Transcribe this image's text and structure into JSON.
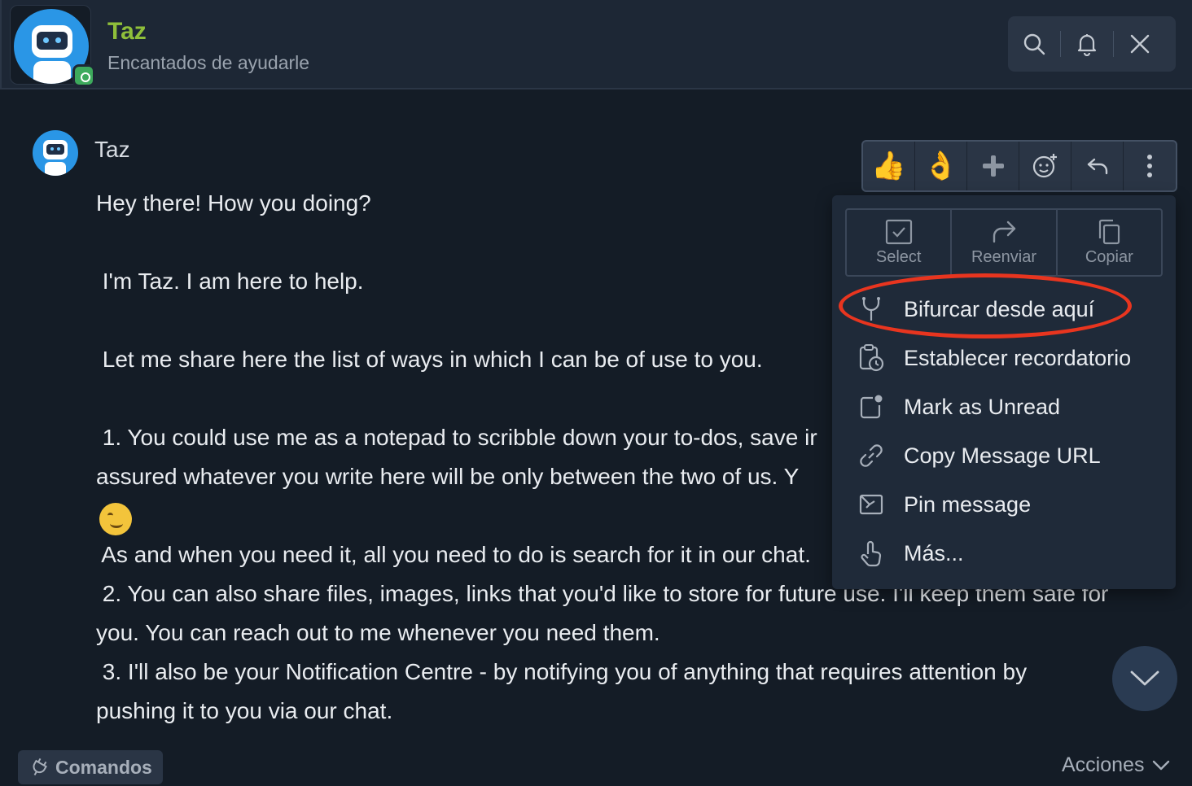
{
  "header": {
    "title": "Taz",
    "subtitle": "Encantados de ayudarle",
    "actions": [
      "search-icon",
      "bell-icon",
      "close-icon"
    ]
  },
  "message": {
    "author": "Taz",
    "lines": [
      "Hey there! How you doing?",
      "",
      " I'm Taz. I am here to help.",
      "",
      " Let me share here the list of ways in which I can be of use to you.",
      "",
      " 1. You could use me as a notepad to scribble down your to-dos, save ir",
      "assured whatever you write here will be only between the two of us. Y",
      "",
      " As and when you need it, all you need to do is search for it in our chat.",
      " 2. You can also share files, images, links that you'd like to store for future use. I'll keep them safe for",
      "you. You can reach out to me whenever you need them.",
      " 3. I'll also be your Notification Centre - by notifying you of anything that requires attention by",
      "pushing it to you via our chat."
    ]
  },
  "reactions": [
    {
      "icon": "thumbs-up-icon",
      "glyph": "👍"
    },
    {
      "icon": "ok-hand-icon",
      "glyph": "👌"
    },
    {
      "icon": "plus-icon",
      "glyph": "✚"
    },
    {
      "icon": "add-reaction-icon",
      "glyph": ""
    },
    {
      "icon": "reply-icon",
      "glyph": ""
    },
    {
      "icon": "more-vertical-icon",
      "glyph": ""
    }
  ],
  "menu": {
    "quick_actions": [
      {
        "label": "Select",
        "icon": "checkbox-icon"
      },
      {
        "label": "Reenviar",
        "icon": "forward-icon"
      },
      {
        "label": "Copiar",
        "icon": "copy-icon"
      }
    ],
    "items": [
      {
        "label": "Bifurcar desde aquí",
        "icon": "fork-icon"
      },
      {
        "label": "Establecer recordatorio",
        "icon": "reminder-icon"
      },
      {
        "label": "Mark as Unread",
        "icon": "unread-icon"
      },
      {
        "label": "Copy Message URL",
        "icon": "link-icon"
      },
      {
        "label": "Pin message",
        "icon": "pin-icon"
      },
      {
        "label": "Más...",
        "icon": "touch-icon"
      }
    ]
  },
  "footer": {
    "commands_label": "Comandos",
    "actions_label": "Acciones"
  },
  "colors": {
    "accent_title": "#8fbf3a",
    "highlight": "#e8351f",
    "background": "#141c26"
  }
}
